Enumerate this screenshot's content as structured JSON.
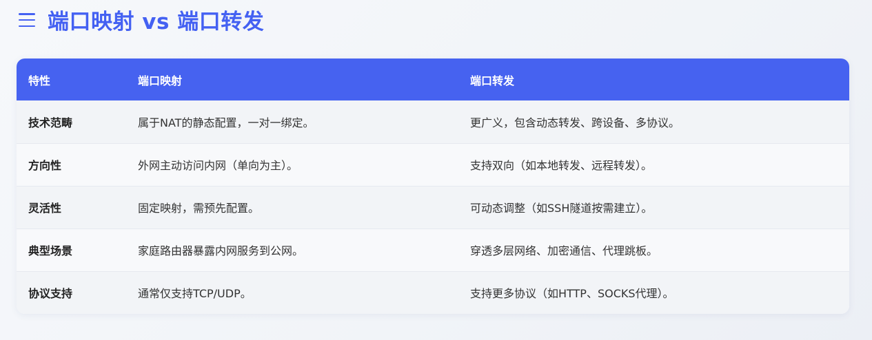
{
  "header": {
    "title": "端口映射 vs 端口转发",
    "menu_icon": "menu-icon"
  },
  "colors": {
    "accent": "#4461f2",
    "header_bg": "#4662f0"
  },
  "table": {
    "columns": [
      "特性",
      "端口映射",
      "端口转发"
    ],
    "rows": [
      [
        "技术范畴",
        "属于NAT的静态配置，一对一绑定。",
        "更广义，包含动态转发、跨设备、多协议。"
      ],
      [
        "方向性",
        "外网主动访问内网（单向为主）。",
        "支持双向（如本地转发、远程转发）。"
      ],
      [
        "灵活性",
        "固定映射，需预先配置。",
        "可动态调整（如SSH隧道按需建立）。"
      ],
      [
        "典型场景",
        "家庭路由器暴露内网服务到公网。",
        "穿透多层网络、加密通信、代理跳板。"
      ],
      [
        "协议支持",
        "通常仅支持TCP/UDP。",
        "支持更多协议（如HTTP、SOCKS代理）。"
      ]
    ]
  }
}
